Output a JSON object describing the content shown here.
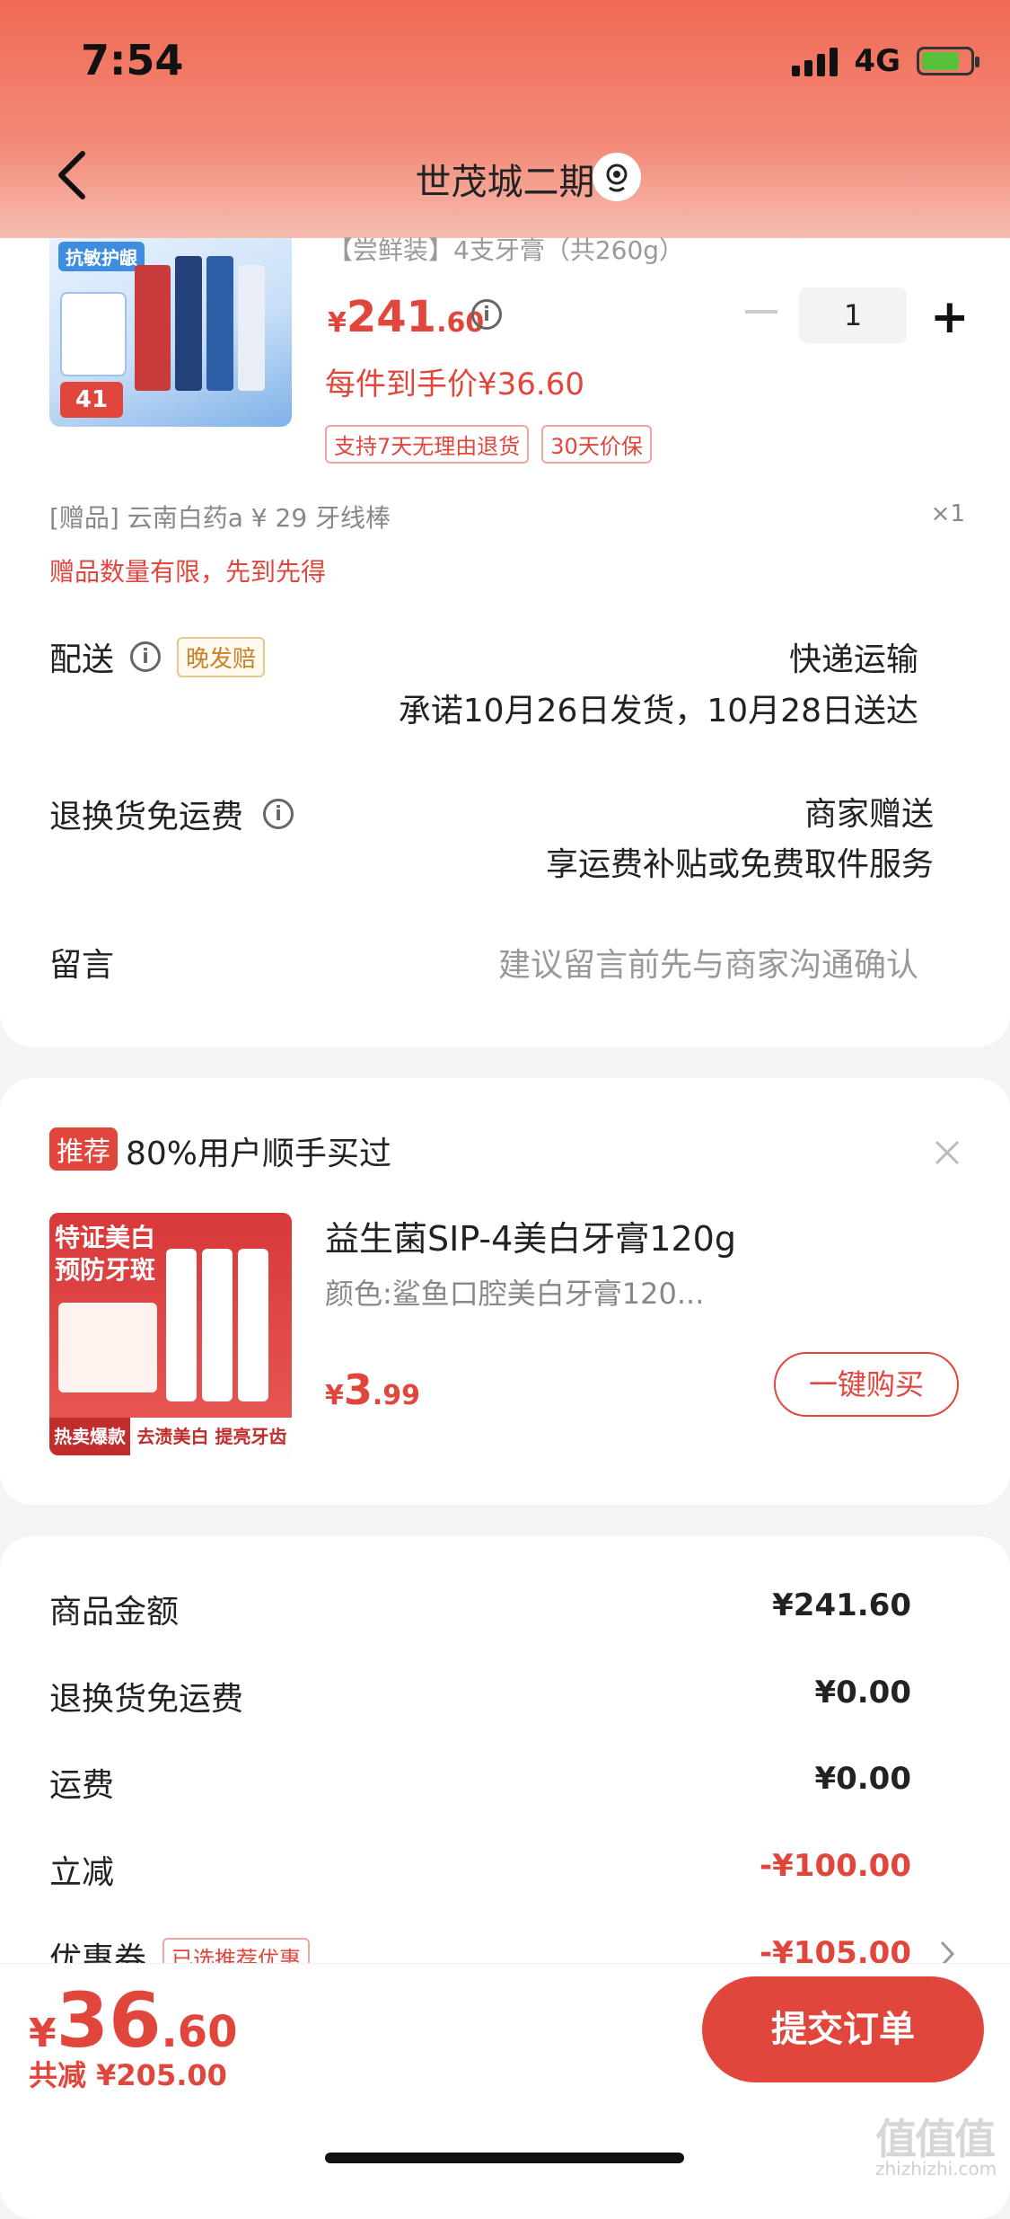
{
  "status_bar": {
    "time": "7:54",
    "network": "4G"
  },
  "nav": {
    "title": "世茂城二期"
  },
  "product": {
    "spec": "【尝鲜装】4支牙膏（共260g）",
    "price_yen": "¥",
    "price_int": "241",
    "price_dec": ".60",
    "quantity": "1",
    "unit_price": "每件到手价¥36.60",
    "tags": [
      "支持7天无理由退货",
      "30天价保"
    ],
    "img_caption": "抗敏护龈",
    "img_badge": "41"
  },
  "gift": {
    "line": "[赠品] 云南白药a ¥ 29 牙线棒",
    "count": "×1",
    "warning": "赠品数量有限，先到先得"
  },
  "delivery": {
    "label": "配送",
    "tag": "晚发赔",
    "method": "快递运输",
    "promise": "承诺10月26日发货，10月28日送达"
  },
  "return_shipping": {
    "label": "退换货免运费",
    "value": "商家赠送",
    "desc": "享运费补贴或免费取件服务"
  },
  "message": {
    "label": "留言",
    "placeholder": "建议留言前先与商家沟通确认"
  },
  "recommend": {
    "badge": "推荐",
    "title": "80%用户顺手买过",
    "name": "益生菌SIP-4美白牙膏120g",
    "spec": "颜色:鲨鱼口腔美白牙膏120...",
    "price_yen": "¥",
    "price_int": "3",
    "price_dec": ".99",
    "buy_label": "一键购买",
    "img_text1": "特证美白",
    "img_text2": "预防牙斑",
    "img_bottom1": "热卖爆款",
    "img_bottom2": "去渍美白 提亮牙齿"
  },
  "summary": [
    {
      "label": "商品金额",
      "value": "¥241.60",
      "red": false
    },
    {
      "label": "退换货免运费",
      "value": "¥0.00",
      "red": false
    },
    {
      "label": "运费",
      "value": "¥0.00",
      "red": false
    },
    {
      "label": "立减",
      "value": "-¥100.00",
      "red": true
    },
    {
      "label": "优惠券",
      "value": "-¥105.00",
      "red": true,
      "tag": "已选推荐优惠"
    }
  ],
  "bottom": {
    "total_yen": "¥",
    "total_int": "36",
    "total_dec": ".60",
    "saved": "共减 ¥205.00",
    "submit_label": "提交订单"
  },
  "watermark": {
    "main": "值值值",
    "sub": "zhizhizhi.com"
  },
  "colors": {
    "accent": "#e1463c",
    "header": "#f06a55"
  }
}
